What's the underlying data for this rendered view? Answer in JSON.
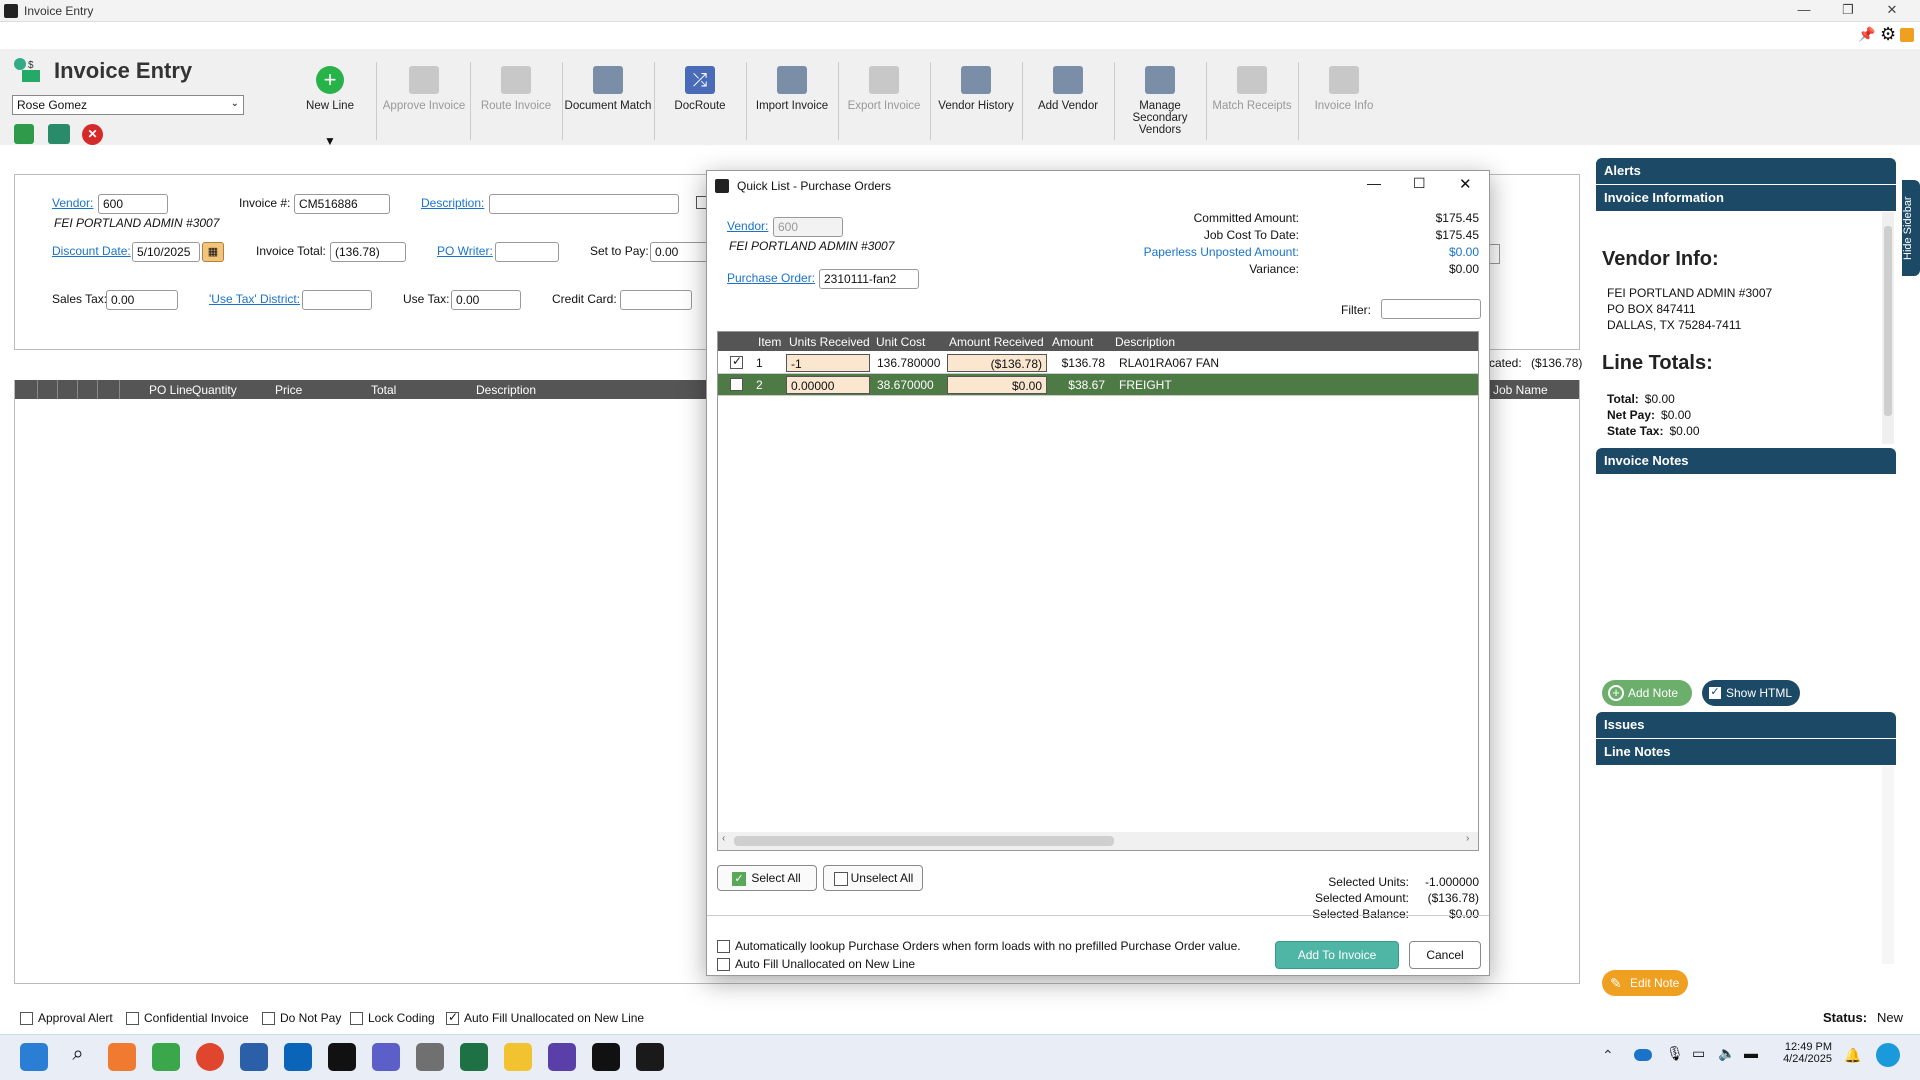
{
  "window": {
    "title": "Invoice Entry"
  },
  "header": {
    "title": "Invoice Entry",
    "user": "Rose Gomez"
  },
  "toolbar": [
    {
      "label": "New Line",
      "enabled": true
    },
    {
      "label": "Approve Invoice",
      "enabled": false
    },
    {
      "label": "Route Invoice",
      "enabled": false
    },
    {
      "label": "Document Match",
      "enabled": true
    },
    {
      "label": "DocRoute",
      "enabled": true
    },
    {
      "label": "Import Invoice",
      "enabled": true
    },
    {
      "label": "Export Invoice",
      "enabled": false
    },
    {
      "label": "Vendor History",
      "enabled": true
    },
    {
      "label": "Add Vendor",
      "enabled": true
    },
    {
      "label": "Manage Secondary Vendors",
      "enabled": true
    },
    {
      "label": "Match Receipts",
      "enabled": false
    },
    {
      "label": "Invoice Info",
      "enabled": false
    }
  ],
  "form": {
    "vendor_label": "Vendor:",
    "vendor_value": "600",
    "vendor_name": "FEI PORTLAND ADMIN #3007",
    "invoice_no_label": "Invoice #:",
    "invoice_no_value": "CM516886",
    "description_label": "Description:",
    "description_value": "",
    "discount_date_label": "Discount Date:",
    "discount_date_value": "5/10/2025",
    "invoice_total_label": "Invoice Total:",
    "invoice_total_value": "(136.78)",
    "po_writer_label": "PO Writer:",
    "po_writer_value": "",
    "set_to_pay_label": "Set to Pay:",
    "set_to_pay_value": "0.00",
    "sales_tax_label": "Sales Tax:",
    "sales_tax_value": "0.00",
    "use_tax_district_label": "'Use Tax' District:",
    "use_tax_district_value": "",
    "use_tax_label": "Use Tax:",
    "use_tax_value": "0.00",
    "credit_card_label": "Credit Card:",
    "credit_card_value": "",
    "unallocated_label": "cated:",
    "unallocated_value": "($136.78)"
  },
  "lines_grid": {
    "columns": [
      "PO Line",
      "Quantity",
      "Price",
      "Total",
      "Description"
    ],
    "job_name_col": "Job Name"
  },
  "bottom_checks": [
    {
      "label": "Approval Alert",
      "checked": false
    },
    {
      "label": "Confidential Invoice",
      "checked": false
    },
    {
      "label": "Do Not Pay",
      "checked": false
    },
    {
      "label": "Lock Coding",
      "checked": false
    },
    {
      "label": "Auto Fill Unallocated on New Line",
      "checked": true
    }
  ],
  "status": {
    "label": "Status:",
    "value": "New"
  },
  "sidebar": {
    "alerts": "Alerts",
    "invoice_info": "Invoice Information",
    "hide": "Hide Sidebar",
    "vendor_info_title": "Vendor Info:",
    "vendor_lines": [
      "FEI PORTLAND ADMIN #3007",
      "PO BOX 847411",
      "DALLAS, TX 75284-7411"
    ],
    "line_totals_title": "Line Totals:",
    "totals": [
      {
        "label": "Total:",
        "value": "$0.00"
      },
      {
        "label": "Net Pay:",
        "value": "$0.00"
      },
      {
        "label": "State Tax:",
        "value": "$0.00"
      }
    ],
    "invoice_notes": "Invoice Notes",
    "add_note": "Add Note",
    "show_html": "Show HTML",
    "issues": "Issues",
    "line_notes": "Line Notes",
    "edit_note": "Edit Note"
  },
  "modal": {
    "title": "Quick List - Purchase Orders",
    "vendor_label": "Vendor:",
    "vendor_value": "600",
    "vendor_name": "FEI PORTLAND ADMIN #3007",
    "po_label": "Purchase Order:",
    "po_value": "2310111-fan2",
    "summary": [
      {
        "label": "Committed Amount:",
        "value": "$175.45",
        "link": false
      },
      {
        "label": "Job Cost To Date:",
        "value": "$175.45",
        "link": false
      },
      {
        "label": "Paperless Unposted Amount:",
        "value": "$0.00",
        "link": true
      },
      {
        "label": "Variance:",
        "value": "$0.00",
        "link": false
      }
    ],
    "filter_label": "Filter:",
    "columns": [
      "Item",
      "Units Received",
      "Unit Cost",
      "Amount Received",
      "Amount",
      "Description"
    ],
    "rows": [
      {
        "checked": true,
        "item": "1",
        "units": "-1",
        "unit_cost": "136.780000",
        "amt_recv": "($136.78)",
        "amount": "$136.78",
        "desc": "RLA01RA067 FAN"
      },
      {
        "checked": false,
        "item": "2",
        "units": "0.00000",
        "unit_cost": "38.670000",
        "amt_recv": "$0.00",
        "amount": "$38.67",
        "desc": "FREIGHT"
      }
    ],
    "select_all": "Select All",
    "unselect_all": "Unselect All",
    "selected": [
      {
        "label": "Selected Units:",
        "value": "-1.000000"
      },
      {
        "label": "Selected Amount:",
        "value": "($136.78)"
      },
      {
        "label": "Selected Balance:",
        "value": "$0.00"
      }
    ],
    "auto_lookup": "Automatically lookup Purchase Orders when form loads with no prefilled Purchase Order value.",
    "auto_fill": "Auto Fill Unallocated on New Line",
    "add_to_invoice": "Add To Invoice",
    "cancel": "Cancel"
  },
  "taskbar": {
    "time": "12:49 PM",
    "date": "4/24/2025"
  }
}
